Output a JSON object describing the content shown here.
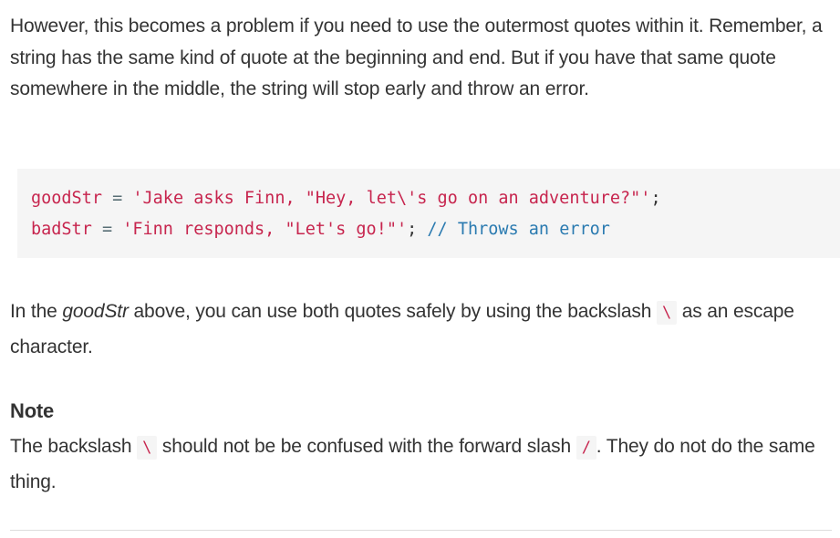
{
  "intro": {
    "text": "However, this becomes a problem if you need to use the outermost quotes within it. Remember, a string has the same kind of quote at the beginning and end. But if you have that same quote somewhere in the middle, the string will stop early and throw an error."
  },
  "code": {
    "line1": {
      "identifier": "goodStr",
      "operator": " = ",
      "string": "'Jake asks Finn, \"Hey, let\\'s go on an adventure?\"'",
      "punct": ";"
    },
    "line2": {
      "identifier": "badStr",
      "operator": " = ",
      "string": "'Finn responds, \"Let's go!\"'",
      "punct": ";",
      "comment": " // Throws an error"
    }
  },
  "explanation": {
    "before": "In the ",
    "emph": "goodStr",
    "middle": " above, you can use both quotes safely by using the backslash ",
    "code": "\\",
    "after": " as an escape character."
  },
  "note": {
    "title": "Note",
    "before": "The backslash ",
    "code1": "\\",
    "middle": " should not be be confused with the forward slash ",
    "code2": "/",
    "after": ". They do not do the same thing."
  }
}
